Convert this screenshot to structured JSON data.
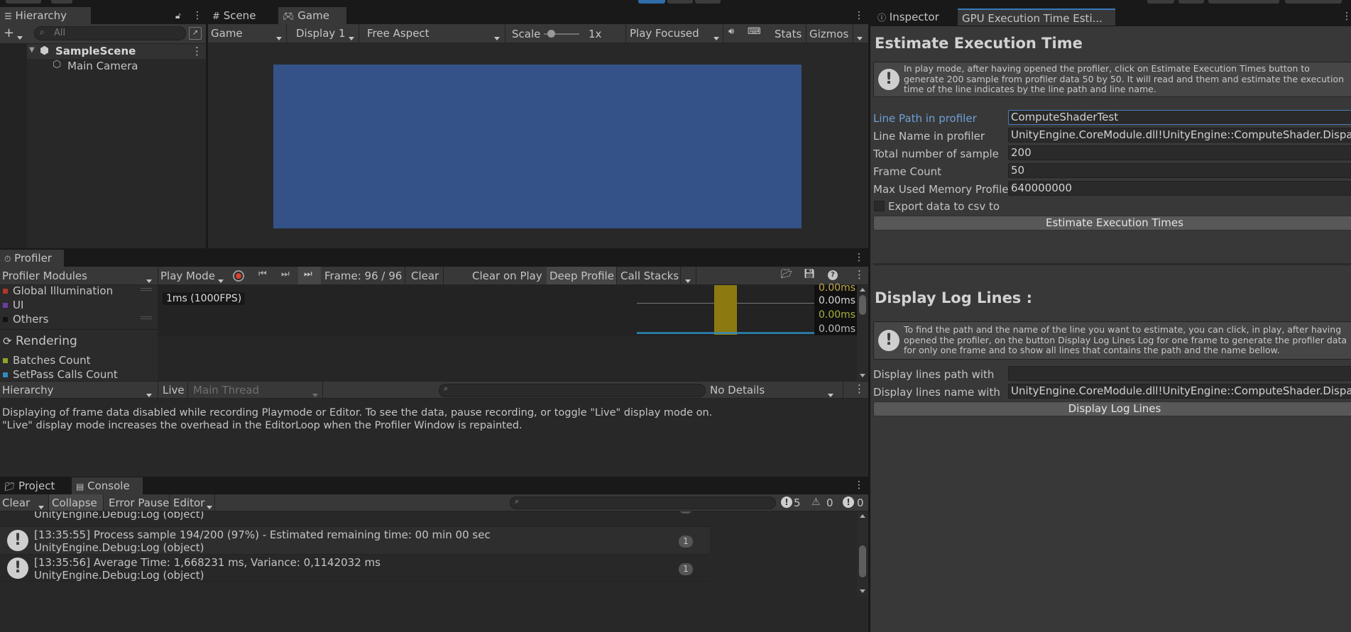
{
  "hierarchy": {
    "tab_label": "Hierarchy",
    "search_placeholder": "All",
    "scene_name": "SampleScene",
    "items": [
      "Main Camera"
    ]
  },
  "game_view": {
    "tabs": [
      "Scene",
      "Game"
    ],
    "display_mode": "Game",
    "display": "Display 1",
    "aspect": "Free Aspect",
    "scale_label": "Scale",
    "scale_value": "1x",
    "play_mode": "Play Focused",
    "stats_label": "Stats",
    "gizmos_label": "Gizmos",
    "viewport_color": "#345287"
  },
  "inspector": {
    "tabs": [
      "Inspector",
      "GPU Execution Time Esti..."
    ],
    "title": "Estimate Execution Time",
    "help_text": "In play mode, after having opened the profiler, click on Estimate Execution Times button to\ngenerate 200 sample from profiler data 50 by 50. It will read and them and estimate the execution\ntime of the line indicates by the line path and line name.",
    "fields": [
      {
        "label": "Line Path in profiler",
        "value": "ComputeShaderTest"
      },
      {
        "label": "Line Name in profiler",
        "value": "UnityEngine.CoreModule.dll!UnityEngine::ComputeShader.Dispatch"
      },
      {
        "label": "Total number of sample",
        "value": "200"
      },
      {
        "label": "Frame Count",
        "value": "50"
      },
      {
        "label": "Max Used Memory Profile",
        "value": "640000000"
      }
    ],
    "export_label": "Export data to csv to",
    "estimate_button": "Estimate Execution Times",
    "display_title": "Display Log Lines :",
    "display_help": "To find the path and the name of the line you want to estimate, you can click, in play, after having\nopened the profiler, on the button Display Log Lines Log for one frame to generate the profiler data\nfor only one frame and to show all lines that contains the path and the name bellow.",
    "display_fields": [
      {
        "label": "Display lines path with",
        "value": ""
      },
      {
        "label": "Display lines name with",
        "value": "UnityEngine.CoreModule.dll!UnityEngine::ComputeShader.Dispatch"
      }
    ],
    "display_button": "Display Log Lines"
  },
  "profiler": {
    "tab_label": "Profiler",
    "modules_label": "Profiler Modules",
    "play_mode": "Play Mode",
    "frame_label": "Frame: 96 / 96",
    "clear": "Clear",
    "clear_on_play": "Clear on Play",
    "deep_profile": "Deep Profile",
    "call_stacks": "Call Stacks",
    "legend_top": [
      {
        "name": "Global Illumination",
        "color": "#b0362b"
      },
      {
        "name": "UI",
        "color": "#6a3ea1"
      },
      {
        "name": "Others",
        "color": "#111111"
      }
    ],
    "rendering_label": "Rendering",
    "legend_rendering": [
      {
        "name": "Batches Count",
        "color": "#8aa62a"
      },
      {
        "name": "SetPass Calls Count",
        "color": "#2e8cc4"
      }
    ],
    "fps_label": "1ms (1000FPS)",
    "readouts": [
      "0.00ms",
      "0.00ms",
      "0.00ms",
      "0.00ms"
    ],
    "hierarchy_label": "Hierarchy",
    "live_label": "Live",
    "thread_label": "Main Thread",
    "details_label": "No Details",
    "message_line1": "Displaying of frame data disabled while recording Playmode or Editor. To see the data, pause recording, or toggle \"Live\" display mode on.",
    "message_line2": " \"Live\" display mode increases the overhead in the EditorLoop when the Profiler Window is repainted."
  },
  "console": {
    "tabs": [
      "Project",
      "Console"
    ],
    "clear": "Clear",
    "collapse": "Collapse",
    "error_pause": "Error Pause",
    "editor": "Editor",
    "counts": {
      "info": "5",
      "warn": "0",
      "error": "0"
    },
    "partial_line": "UnityEngine.Debug:Log (object)",
    "logs": [
      {
        "line1": "[13:35:55] Process sample 194/200 (97%) - Estimated remaining time: 00 min 00 sec",
        "line2": "UnityEngine.Debug:Log (object)",
        "count": "1"
      },
      {
        "line1": "[13:35:56] Average Time: 1,668231 ms, Variance: 0,1142032 ms",
        "line2": "UnityEngine.Debug:Log (object)",
        "count": "1"
      }
    ]
  }
}
